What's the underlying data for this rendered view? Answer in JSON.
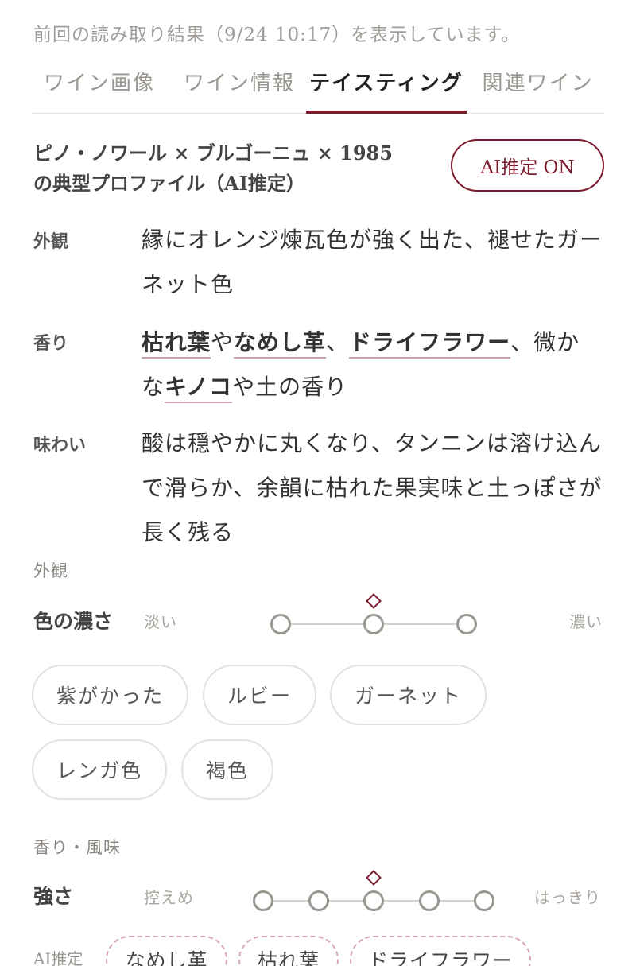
{
  "notice": "前回の読み取り結果（9/24 10:17）を表示しています。",
  "tabs": [
    {
      "label": "ワイン画像"
    },
    {
      "label": "ワイン情報"
    },
    {
      "label": "テイスティング"
    },
    {
      "label": "関連ワイン"
    }
  ],
  "active_tab": "テイスティング",
  "profile": {
    "title_line1": "ピノ・ノワール × ブルゴーニュ × 1985",
    "title_line2": "の典型プロファイル（AI推定）",
    "ai_toggle_label": "AI推定 ON"
  },
  "descriptions": {
    "appearance": {
      "label": "外観",
      "text": "縁にオレンジ煉瓦色が強く出た、褪せたガーネット色"
    },
    "aroma": {
      "label": "香り",
      "parts": [
        "枯れ葉",
        "や",
        "なめし革",
        "、",
        "ドライフラワー",
        "、微かな",
        "キノコ",
        "や土の香り"
      ]
    },
    "taste": {
      "label": "味わい",
      "text": "酸は穏やかに丸くなり、タンニンは溶け込んで滑らか、余韻に枯れた果実味と土っぽさが長く残る"
    }
  },
  "appearance_section": {
    "label": "外観",
    "scale": {
      "label": "色の濃さ",
      "min_label": "淡い",
      "max_label": "濃い",
      "steps": 3,
      "selected": 2
    },
    "color_chips": [
      "紫がかった",
      "ルビー",
      "ガーネット",
      "レンガ色",
      "褐色"
    ]
  },
  "aroma_section": {
    "label": "香り・風味",
    "scale": {
      "label": "強さ",
      "min_label": "控えめ",
      "max_label": "はっきり",
      "steps": 5,
      "selected": 3
    },
    "ai_hint_label": "AI推定",
    "ai_chips": [
      "なめし革",
      "枯れ葉",
      "ドライフラワー"
    ]
  }
}
